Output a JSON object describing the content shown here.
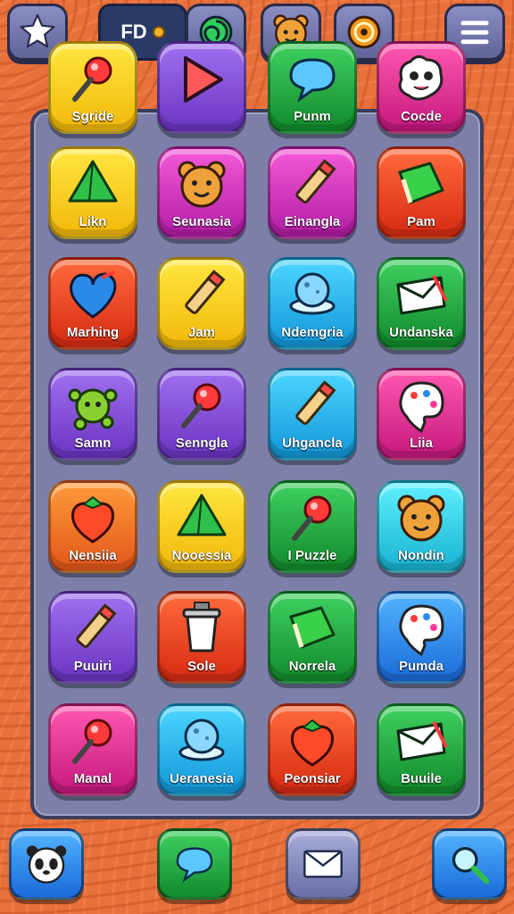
{
  "top_bar": {
    "logo_text": "FD",
    "buttons": [
      {
        "icon": "star-puzzle-icon"
      },
      {
        "icon": "swirl-icon"
      },
      {
        "icon": "bear-icon"
      },
      {
        "icon": "target-icon"
      },
      {
        "icon": "menu-icon"
      }
    ]
  },
  "apps": [
    {
      "label": "Sgride",
      "icon": "pushpin-icon",
      "color": "#f2c51a"
    },
    {
      "label": "",
      "icon": "play-arrow-icon",
      "color": "#8e4ad8"
    },
    {
      "label": "Punm",
      "icon": "chat-bubble-icon",
      "color": "#1aa83a"
    },
    {
      "label": "Cocde",
      "icon": "monster-face-icon",
      "color": "#d8208a"
    },
    {
      "label": "Likn",
      "icon": "tent-icon",
      "color": "#f2c51a"
    },
    {
      "label": "Seunasia",
      "icon": "bear-icon",
      "color": "#c93ac0"
    },
    {
      "label": "Einangla",
      "icon": "pencil-icon",
      "color": "#c93ac0"
    },
    {
      "label": "Pam",
      "icon": "book-icon",
      "color": "#e8401a"
    },
    {
      "label": "Marhing",
      "icon": "heart-icon",
      "color": "#e8401a"
    },
    {
      "label": "Jam",
      "icon": "pencil-icon",
      "color": "#f2c51a"
    },
    {
      "label": "Ndemgria",
      "icon": "globe-icon",
      "color": "#1aa6e8"
    },
    {
      "label": "Undanska",
      "icon": "envelope-icon",
      "color": "#1aa83a"
    },
    {
      "label": "Samn",
      "icon": "germ-icon",
      "color": "#8e4ad8"
    },
    {
      "label": "Senngla",
      "icon": "pushpin-icon",
      "color": "#8e4ad8"
    },
    {
      "label": "Uhgancla",
      "icon": "pencil-icon",
      "color": "#1aa6e8"
    },
    {
      "label": "Liia",
      "icon": "palette-icon",
      "color": "#c4187c"
    },
    {
      "label": "Nensiia",
      "icon": "strawberry-icon",
      "color": "#f06a2a"
    },
    {
      "label": "Nooessia",
      "icon": "tent-icon",
      "color": "#f2c51a"
    },
    {
      "label": "I Puzzle",
      "icon": "pushpin-icon",
      "color": "#1aa83a"
    },
    {
      "label": "Nondin",
      "icon": "bear-icon",
      "color": "#2ac8e8"
    },
    {
      "label": "Puuiri",
      "icon": "pencil-icon",
      "color": "#8e4ad8"
    },
    {
      "label": "Sole",
      "icon": "cup-icon",
      "color": "#e8401a"
    },
    {
      "label": "Norrela",
      "icon": "book-icon",
      "color": "#1aa83a"
    },
    {
      "label": "Pumda",
      "icon": "palette-icon",
      "color": "#1a8ae8"
    },
    {
      "label": "Manal",
      "icon": "pushpin-icon",
      "color": "#d8208a"
    },
    {
      "label": "Ueranesia",
      "icon": "globe-icon",
      "color": "#1aa6e8"
    },
    {
      "label": "Peonsiar",
      "icon": "strawberry-icon",
      "color": "#e8401a"
    },
    {
      "label": "Buuile",
      "icon": "envelope-icon",
      "color": "#1aa83a"
    }
  ],
  "bottom_bar": [
    {
      "icon": "panda-icon",
      "color": "#1a8ae8"
    },
    {
      "icon": "chat-bubble-icon",
      "color": "#1aa83a"
    },
    {
      "icon": "mail-icon",
      "color": "#8a8ec4"
    },
    {
      "icon": "search-icon",
      "color": "#1a8ae8"
    }
  ]
}
